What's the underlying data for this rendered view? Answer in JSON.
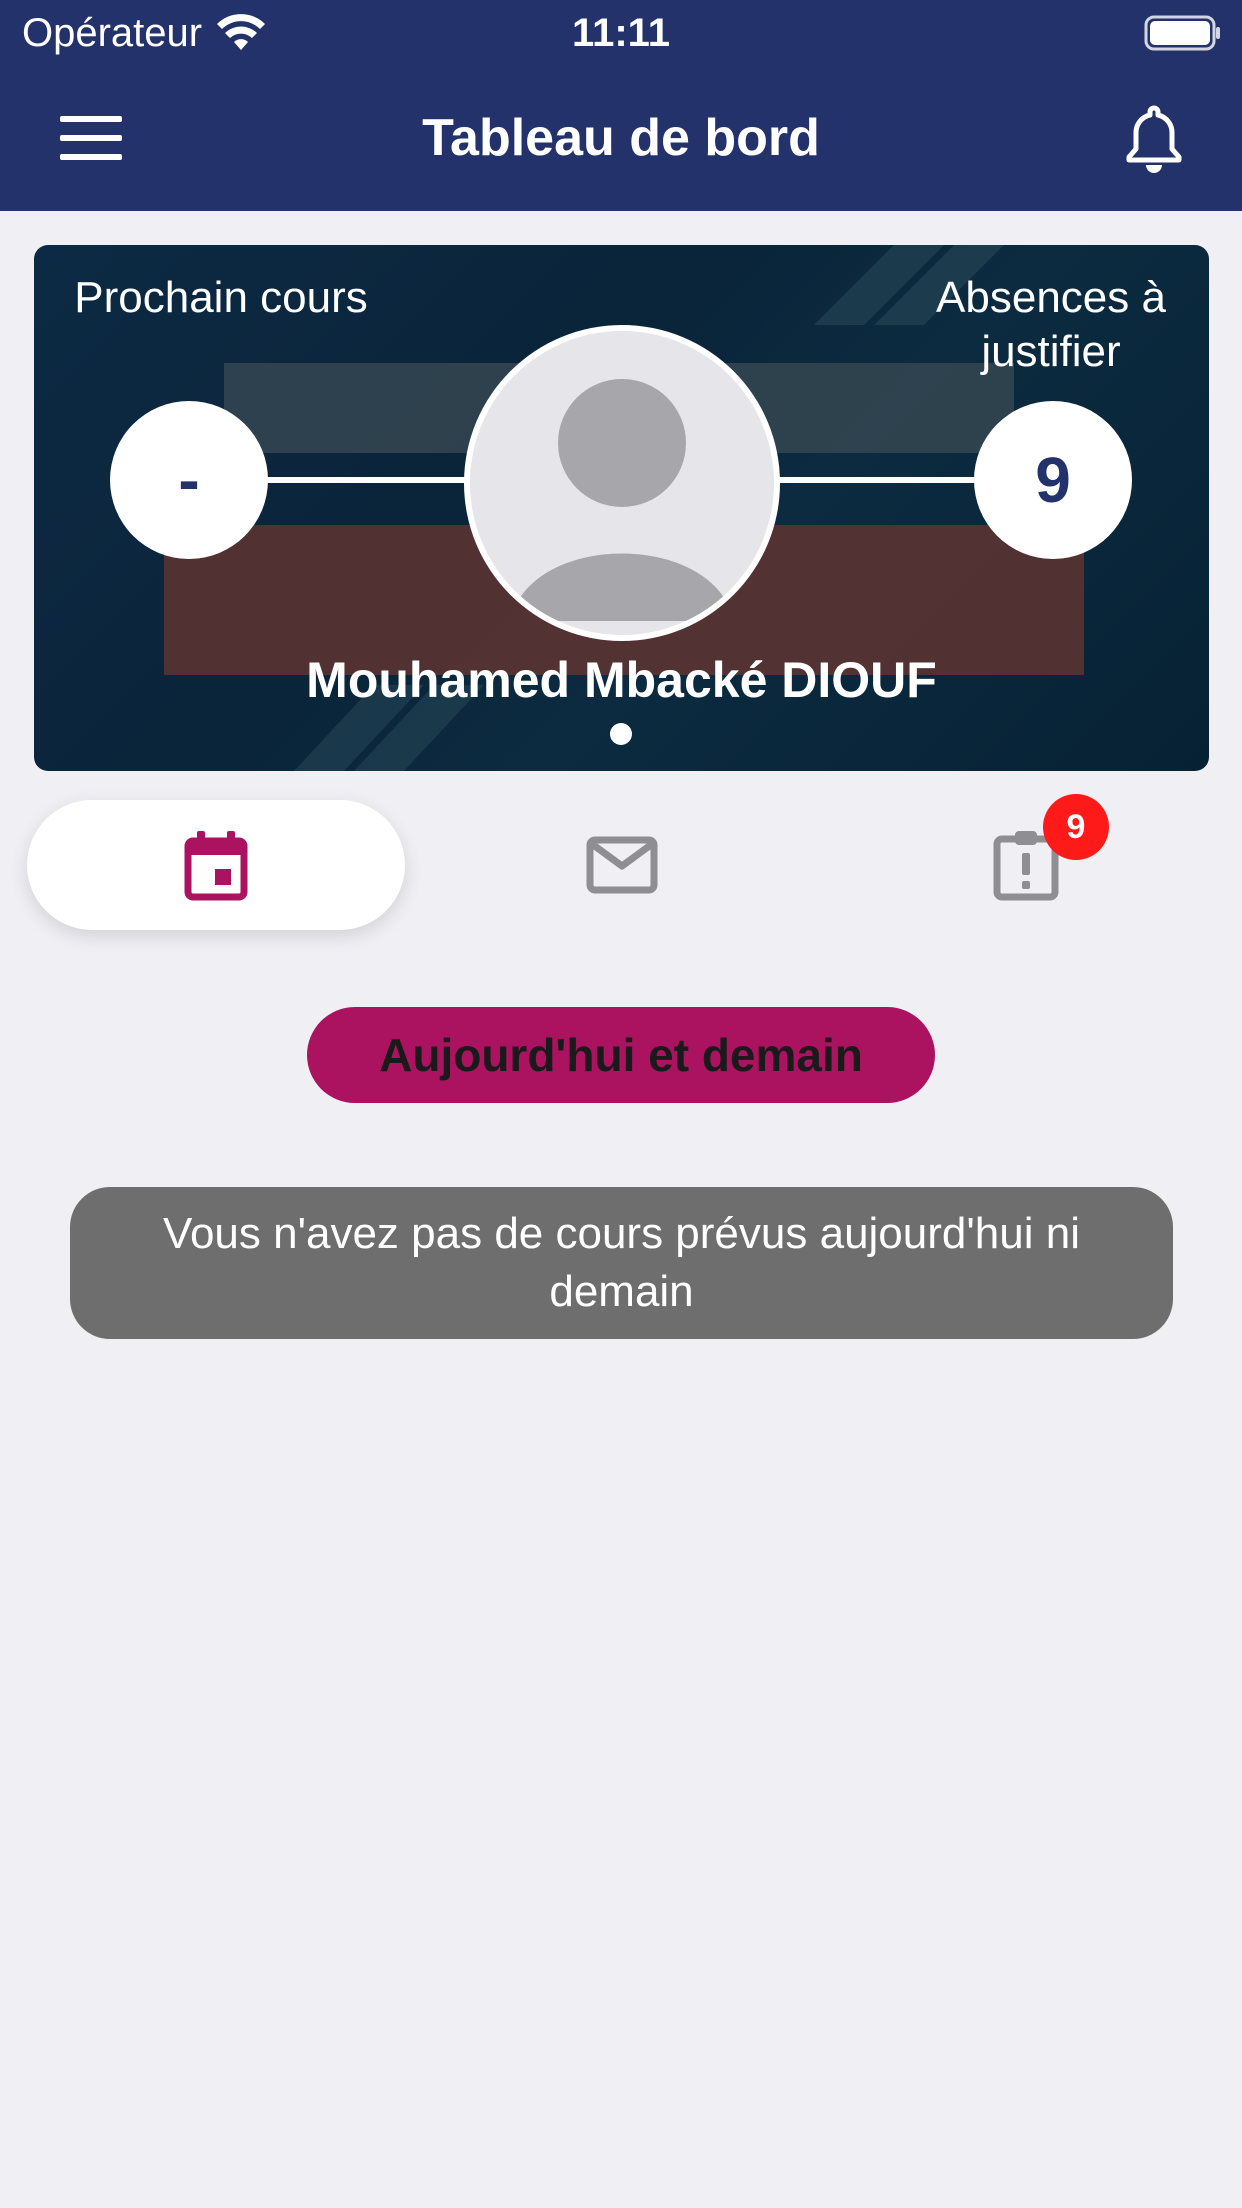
{
  "status_bar": {
    "carrier": "Opérateur",
    "time": "11:11"
  },
  "nav": {
    "title": "Tableau de bord",
    "menu_icon": "hamburger-menu-icon",
    "bell_icon": "bell-icon"
  },
  "banner": {
    "next_course_label": "Prochain cours",
    "next_course_value": "-",
    "absences_label": "Absences à justifier",
    "absences_value": "9",
    "user_name": "Mouhamed Mbacké DIOUF"
  },
  "tabs": [
    {
      "name": "calendar",
      "icon": "calendar-icon",
      "selected": true
    },
    {
      "name": "messages",
      "icon": "mail-icon",
      "selected": false
    },
    {
      "name": "absences",
      "icon": "clipboard-alert-icon",
      "selected": false,
      "badge": "9"
    }
  ],
  "content": {
    "filter_label": "Aujourd'hui et demain",
    "empty_message": "Vous n'avez pas de cours prévus aujourd'hui ni demain"
  },
  "colors": {
    "header": "#23326a",
    "accent": "#ab1260",
    "badge": "#ff1a1a",
    "background": "#efeff4"
  }
}
